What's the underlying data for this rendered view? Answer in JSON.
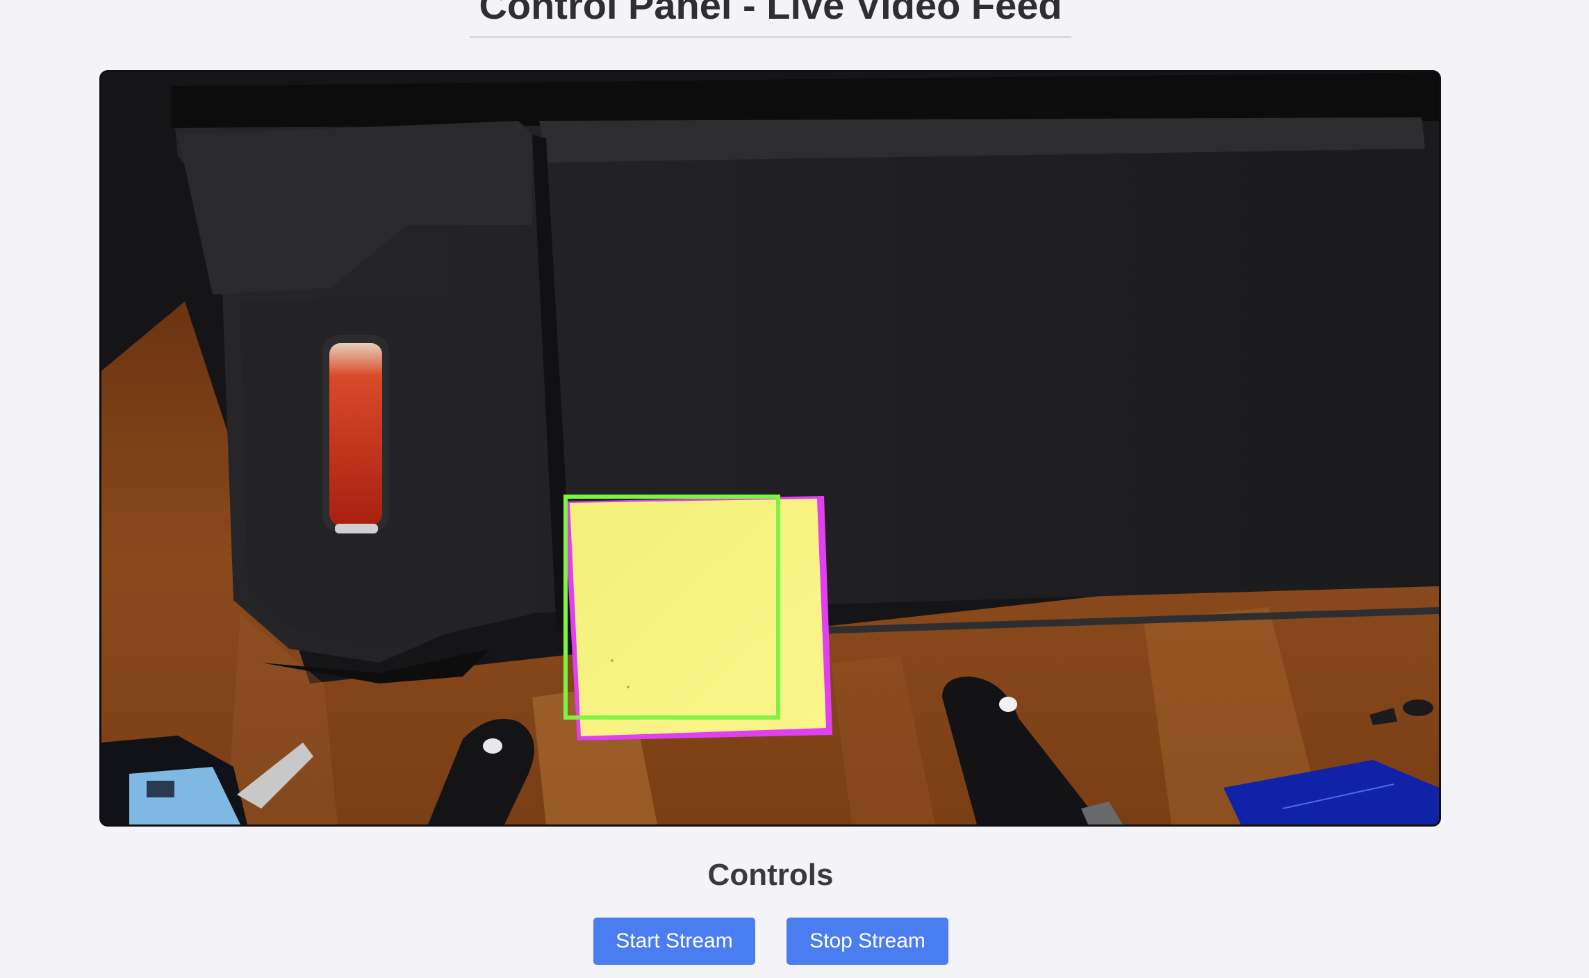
{
  "header": {
    "title": "Control Panel - Live Video Feed"
  },
  "video": {
    "detection_box_color": "#7ef442",
    "object_outline_color": "#e040f0",
    "object_fill_color": "#f6f27a"
  },
  "controls": {
    "heading": "Controls",
    "start_label": "Start Stream",
    "stop_label": "Stop Stream",
    "button_color": "#4a7df0"
  }
}
